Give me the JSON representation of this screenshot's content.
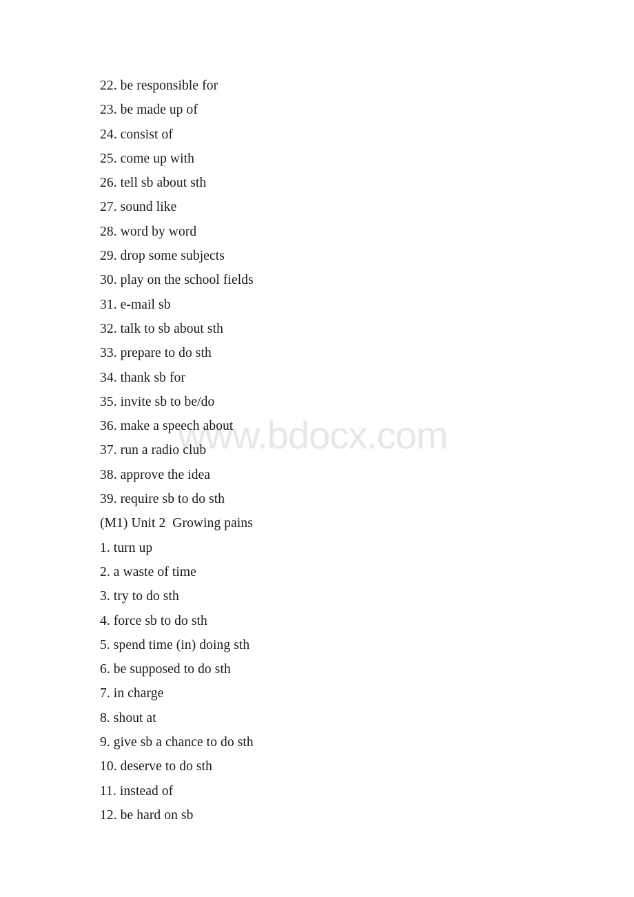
{
  "document": {
    "watermark": "www.bdocx.com",
    "background_color": "#ffffff",
    "text_color": "#1a1a1a",
    "watermark_color": "#e7e7e7",
    "lines": [
      {
        "id": "l1",
        "text": "22. be responsible for",
        "type": "list-item"
      },
      {
        "id": "l2",
        "text": "23. be made up of",
        "type": "list-item"
      },
      {
        "id": "l3",
        "text": "24. consist of",
        "type": "list-item"
      },
      {
        "id": "l4",
        "text": "25. come up with",
        "type": "list-item"
      },
      {
        "id": "l5",
        "text": "26. tell sb about sth",
        "type": "list-item"
      },
      {
        "id": "l6",
        "text": "27. sound like",
        "type": "list-item"
      },
      {
        "id": "l7",
        "text": "28. word by word",
        "type": "list-item"
      },
      {
        "id": "l8",
        "text": "29. drop some subjects",
        "type": "list-item"
      },
      {
        "id": "l9",
        "text": "30. play on the school fields",
        "type": "list-item"
      },
      {
        "id": "l10",
        "text": "31. e-mail sb",
        "type": "list-item"
      },
      {
        "id": "l11",
        "text": "32. talk to sb about sth",
        "type": "list-item"
      },
      {
        "id": "l12",
        "text": "33. prepare to do sth",
        "type": "list-item"
      },
      {
        "id": "l13",
        "text": "34. thank sb for",
        "type": "list-item"
      },
      {
        "id": "l14",
        "text": "35. invite sb to be/do",
        "type": "list-item"
      },
      {
        "id": "l15",
        "text": "36. make a speech about",
        "type": "list-item"
      },
      {
        "id": "l16",
        "text": "37. run a radio club",
        "type": "list-item"
      },
      {
        "id": "l17",
        "text": "38. approve the idea",
        "type": "list-item"
      },
      {
        "id": "l18",
        "text": "39. require sb to do sth",
        "type": "list-item"
      },
      {
        "id": "l19",
        "text": "(M1) Unit 2  Growing pains",
        "type": "heading"
      },
      {
        "id": "l20",
        "text": "1. turn up",
        "type": "list-item"
      },
      {
        "id": "l21",
        "text": "2. a waste of time",
        "type": "list-item"
      },
      {
        "id": "l22",
        "text": "3. try to do sth",
        "type": "list-item"
      },
      {
        "id": "l23",
        "text": "4. force sb to do sth",
        "type": "list-item"
      },
      {
        "id": "l24",
        "text": "5. spend time (in) doing sth",
        "type": "list-item"
      },
      {
        "id": "l25",
        "text": "6. be supposed to do sth",
        "type": "list-item"
      },
      {
        "id": "l26",
        "text": "7. in charge",
        "type": "list-item"
      },
      {
        "id": "l27",
        "text": "8. shout at",
        "type": "list-item"
      },
      {
        "id": "l28",
        "text": "9. give sb a chance to do sth",
        "type": "list-item"
      },
      {
        "id": "l29",
        "text": "10. deserve to do sth",
        "type": "list-item"
      },
      {
        "id": "l30",
        "text": "11. instead of",
        "type": "list-item"
      },
      {
        "id": "l31",
        "text": "12. be hard on sb",
        "type": "list-item"
      }
    ]
  }
}
